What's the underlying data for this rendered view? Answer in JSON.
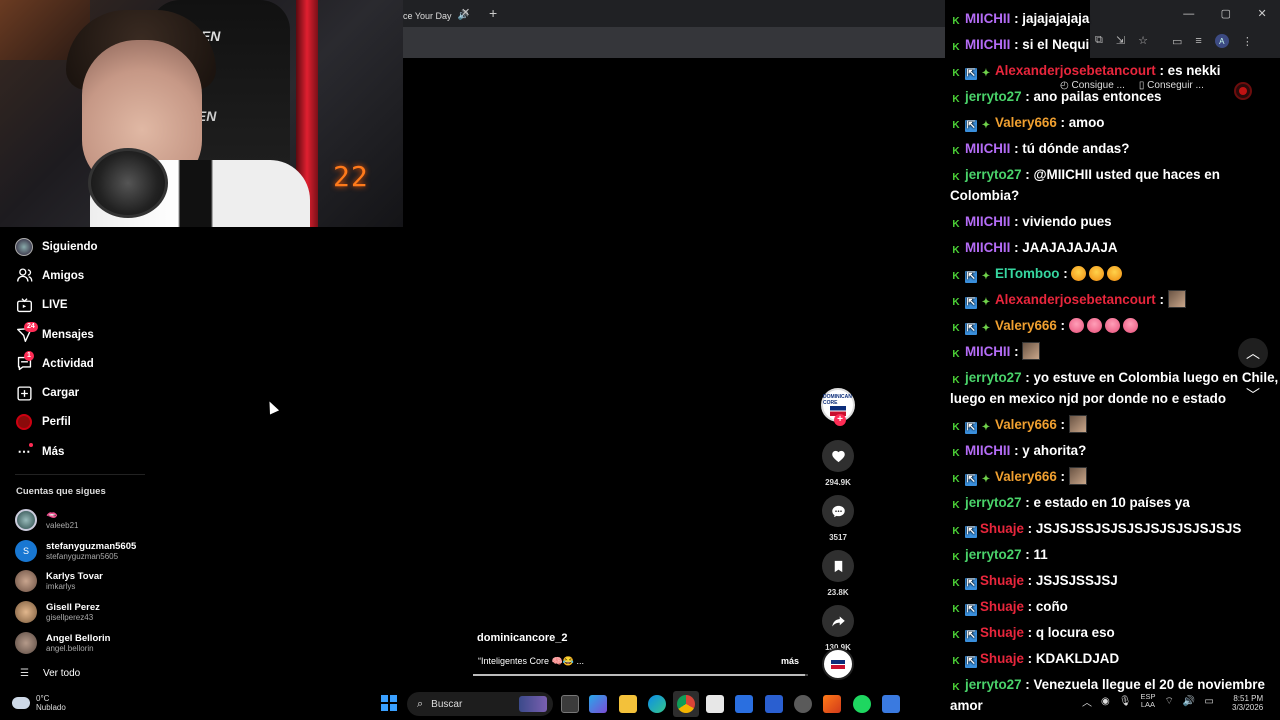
{
  "browser": {
    "tab_title": "ce Your Day",
    "tab_audio": "🔊",
    "tab_close": "✕",
    "new_tab": "+",
    "window_controls": [
      "—",
      "▢",
      "✕"
    ],
    "bookmark_1": "Consigue ...",
    "bookmark_2": "Conseguir ...",
    "profile_letter": "A"
  },
  "webcam": {
    "timer": "22",
    "chair_brand": "GEN",
    "chair_brand_2": "GEN"
  },
  "sidebar": {
    "items": [
      {
        "label": "Siguiendo",
        "icon": "following-avatar-icon"
      },
      {
        "label": "Amigos",
        "icon": "friends-icon"
      },
      {
        "label": "LIVE",
        "icon": "live-icon"
      },
      {
        "label": "Mensajes",
        "icon": "messages-icon",
        "badge": "24"
      },
      {
        "label": "Actividad",
        "icon": "activity-icon",
        "badge": "1"
      },
      {
        "label": "Cargar",
        "icon": "upload-icon"
      },
      {
        "label": "Perfil",
        "icon": "profile-icon"
      },
      {
        "label": "Más",
        "icon": "more-icon"
      }
    ],
    "following_title": "Cuentas que sigues",
    "following": [
      {
        "name": "🫦",
        "handle": "valeeb21",
        "color": "#6a8a8a"
      },
      {
        "name": "stefanyguzman5605",
        "handle": "stefanyguzman5605",
        "color": "#1877d2",
        "initial": "S"
      },
      {
        "name": "Karlys Tovar",
        "handle": "imkarlys",
        "color": "#8b6f5c"
      },
      {
        "name": "Gisell Perez",
        "handle": "gisellperez43",
        "color": "#a77f5c"
      },
      {
        "name": "Angel Bellorin",
        "handle": "angel.bellorin",
        "color": "#7d6a60"
      }
    ],
    "see_all": "Ver todo",
    "see_all_icon": "☰"
  },
  "video": {
    "author": "dominicancore_2",
    "caption": "“Inteligentes Core 🧠😂 ...",
    "more": "más",
    "creator_badge": "DOMINICAN CORE",
    "progress": 0.99,
    "likes": "294.9K",
    "comments": "3517",
    "saves": "23.8K",
    "shares": "130.9K",
    "follow_plus": "+"
  },
  "chat": {
    "colors": {
      "purple": "#b46cf5",
      "green": "#4ad36a",
      "orange": "#f0a030",
      "red": "#e8263c",
      "teal": "#36d6a0",
      "white": "#ffffff"
    },
    "messages": [
      {
        "user": "MIICHII",
        "color": "purple",
        "badges": [
          "k"
        ],
        "text": "jajajajajaja"
      },
      {
        "user": "MIICHII",
        "color": "purple",
        "badges": [
          "k"
        ],
        "text": "si el Nequi"
      },
      {
        "user": "Alexanderjosebetancourt",
        "color": "red",
        "badges": [
          "k",
          "x",
          "s"
        ],
        "text": "es nekki"
      },
      {
        "user": "jerryto27",
        "color": "green",
        "badges": [
          "k"
        ],
        "text": "ano pailas entonces"
      },
      {
        "user": "Valery666",
        "color": "orange",
        "badges": [
          "k",
          "x",
          "s"
        ],
        "text": "amoo"
      },
      {
        "user": "MIICHII",
        "color": "purple",
        "badges": [
          "k"
        ],
        "text": "tú dónde andas?"
      },
      {
        "user": "jerryto27",
        "color": "green",
        "badges": [
          "k"
        ],
        "text": "@MIICHII usted que haces en Colombia?"
      },
      {
        "user": "MIICHII",
        "color": "purple",
        "badges": [
          "k"
        ],
        "text": "viviendo pues"
      },
      {
        "user": "MIICHII",
        "color": "purple",
        "badges": [
          "k"
        ],
        "text": "JAAJAJAJAJA"
      },
      {
        "user": "ElTomboo",
        "color": "teal",
        "badges": [
          "k",
          "x",
          "s"
        ],
        "text": "",
        "emotes": [
          "lol",
          "lol",
          "lol"
        ]
      },
      {
        "user": "Alexanderjosebetancourt",
        "color": "red",
        "badges": [
          "k",
          "x",
          "s"
        ],
        "text": "",
        "sticker": true
      },
      {
        "user": "Valery666",
        "color": "orange",
        "badges": [
          "k",
          "x",
          "s"
        ],
        "text": "",
        "emotes": [
          "star",
          "star",
          "star",
          "star"
        ]
      },
      {
        "user": "MIICHII",
        "color": "purple",
        "badges": [
          "k"
        ],
        "text": "",
        "sticker": true
      },
      {
        "user": "jerryto27",
        "color": "green",
        "badges": [
          "k"
        ],
        "text": "yo estuve en Colombia luego en Chile, luego en mexico njd por donde no e estado"
      },
      {
        "user": "Valery666",
        "color": "orange",
        "badges": [
          "k",
          "x",
          "s"
        ],
        "text": "",
        "sticker": true
      },
      {
        "user": "MIICHII",
        "color": "purple",
        "badges": [
          "k"
        ],
        "text": "y ahorita?"
      },
      {
        "user": "Valery666",
        "color": "orange",
        "badges": [
          "k",
          "x",
          "s"
        ],
        "text": "",
        "sticker": true
      },
      {
        "user": "jerryto27",
        "color": "green",
        "badges": [
          "k"
        ],
        "text": "e estado en 10 países ya"
      },
      {
        "user": "Shuaje",
        "color": "red",
        "badges": [
          "k",
          "x"
        ],
        "text": "JSJSJSSJSJSJSJSJSJSJSJSJS"
      },
      {
        "user": "jerryto27",
        "color": "green",
        "badges": [
          "k"
        ],
        "text": "11"
      },
      {
        "user": "Shuaje",
        "color": "red",
        "badges": [
          "k",
          "x"
        ],
        "text": "JSJSJSSJSJ"
      },
      {
        "user": "Shuaje",
        "color": "red",
        "badges": [
          "k",
          "x"
        ],
        "text": "coño"
      },
      {
        "user": "Shuaje",
        "color": "red",
        "badges": [
          "k",
          "x"
        ],
        "text": "q locura eso"
      },
      {
        "user": "Shuaje",
        "color": "red",
        "badges": [
          "k",
          "x"
        ],
        "text": "KDAKLDJAD"
      },
      {
        "user": "jerryto27",
        "color": "green",
        "badges": [
          "k"
        ],
        "text": "Venezuela llegue el 20 de noviembre amor"
      }
    ]
  },
  "taskbar": {
    "weather_temp": "0°C",
    "weather_desc": "Nublado",
    "search_placeholder": "Buscar",
    "lang_1": "ESP",
    "lang_2": "LAA",
    "time": "8:51 PM",
    "date": "3/3/2026"
  }
}
